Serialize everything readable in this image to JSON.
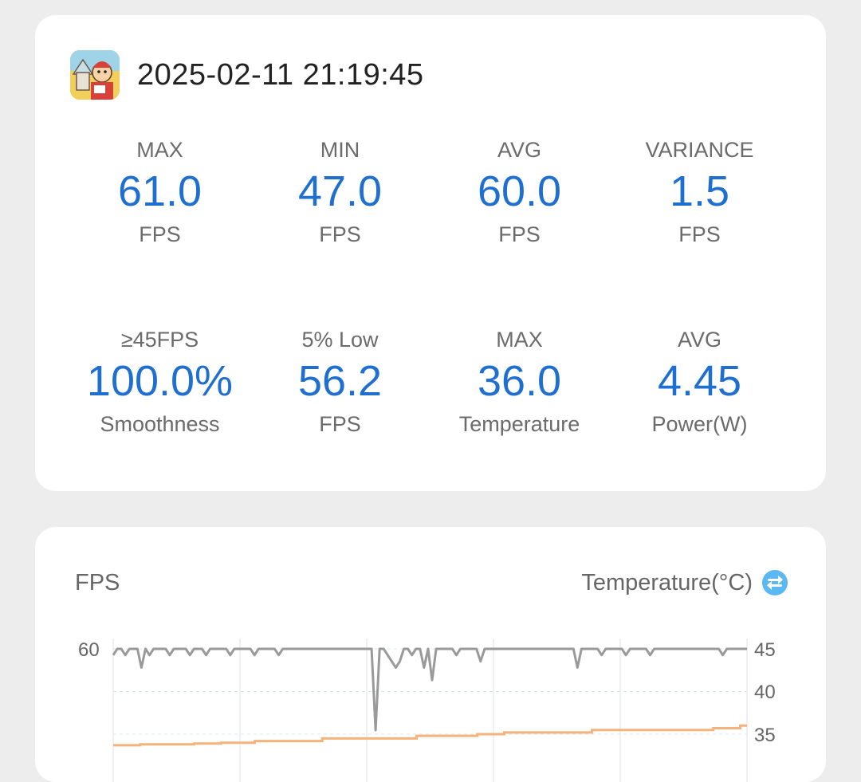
{
  "session": {
    "timestamp": "2025-02-11 21:19:45",
    "app_icon": "game-app-icon"
  },
  "stats": [
    {
      "label": "MAX",
      "value": "61.0",
      "unit": "FPS"
    },
    {
      "label": "MIN",
      "value": "47.0",
      "unit": "FPS"
    },
    {
      "label": "AVG",
      "value": "60.0",
      "unit": "FPS"
    },
    {
      "label": "VARIANCE",
      "value": "1.5",
      "unit": "FPS"
    },
    {
      "label": "≥45FPS",
      "value": "100.0%",
      "unit": "Smoothness"
    },
    {
      "label": "5% Low",
      "value": "56.2",
      "unit": "FPS"
    },
    {
      "label": "MAX",
      "value": "36.0",
      "unit": "Temperature"
    },
    {
      "label": "AVG",
      "value": "4.45",
      "unit": "Power(W)"
    }
  ],
  "chart": {
    "left_title": "FPS",
    "right_title": "Temperature(°C)",
    "swap_icon": "swap-icon",
    "colors": {
      "fps": "#9a9a9a",
      "temperature": "#f5b27a",
      "value": "#1f6fd0",
      "swap": "#5bb8f0"
    }
  },
  "chart_data": {
    "type": "line",
    "left_axis": {
      "ticks": [
        "60"
      ]
    },
    "right_axis": {
      "ticks": [
        "45",
        "40",
        "35"
      ]
    },
    "series": [
      {
        "values": [
          59,
          60,
          60,
          59,
          60,
          60,
          60,
          57,
          60,
          59,
          60,
          60,
          60,
          60,
          59,
          60,
          60,
          60,
          60,
          59,
          60,
          60,
          60,
          59,
          60,
          60,
          60,
          60,
          60,
          59,
          60,
          60,
          60,
          60,
          60,
          59,
          60,
          60,
          60,
          60,
          60,
          59,
          60,
          60,
          60,
          60,
          60,
          60,
          60,
          60,
          60,
          60,
          60,
          60,
          60,
          60,
          60,
          60,
          60,
          60,
          60,
          60,
          60,
          60,
          60,
          47,
          60,
          60,
          59,
          58,
          57,
          58,
          60,
          60,
          59,
          60,
          60,
          57,
          60,
          55,
          60,
          60,
          60,
          60,
          60,
          59,
          60,
          60,
          60,
          60,
          60,
          58,
          60,
          60,
          60,
          60,
          60,
          60,
          60,
          60,
          60,
          60,
          60,
          60,
          60,
          60,
          60,
          60,
          60,
          60,
          60,
          60,
          60,
          60,
          60,
          57,
          60,
          60,
          60,
          60,
          60,
          59,
          60,
          60,
          60,
          60,
          60,
          59,
          60,
          60,
          60,
          60,
          60,
          59,
          60,
          60,
          60,
          60,
          60,
          60,
          60,
          60,
          60,
          60,
          60,
          60,
          60,
          60,
          60,
          60,
          60,
          59,
          60,
          60,
          60,
          60,
          60,
          60
        ]
      },
      {
        "values": [
          33.7,
          33.7,
          33.7,
          33.7,
          33.8,
          33.8,
          33.8,
          33.8,
          33.8,
          33.8,
          33.8,
          33.8,
          33.9,
          33.9,
          33.9,
          33.9,
          34.0,
          34.0,
          34.0,
          34.0,
          34.0,
          34.2,
          34.2,
          34.2,
          34.2,
          34.2,
          34.2,
          34.2,
          34.2,
          34.2,
          34.2,
          34.5,
          34.5,
          34.5,
          34.5,
          34.5,
          34.5,
          34.5,
          34.5,
          34.5,
          34.5,
          34.5,
          34.5,
          34.5,
          34.5,
          34.8,
          34.8,
          34.8,
          34.8,
          34.8,
          34.8,
          34.8,
          34.8,
          34.8,
          35.0,
          35.0,
          35.0,
          35.0,
          35.2,
          35.2,
          35.2,
          35.2,
          35.2,
          35.2,
          35.2,
          35.2,
          35.2,
          35.2,
          35.2,
          35.2,
          35.2,
          35.5,
          35.5,
          35.5,
          35.5,
          35.5,
          35.5,
          35.5,
          35.5,
          35.5,
          35.5,
          35.5,
          35.5,
          35.5,
          35.5,
          35.5,
          35.5,
          35.5,
          35.5,
          35.7,
          35.7,
          35.7,
          35.7,
          36.0,
          36.0
        ]
      }
    ]
  }
}
